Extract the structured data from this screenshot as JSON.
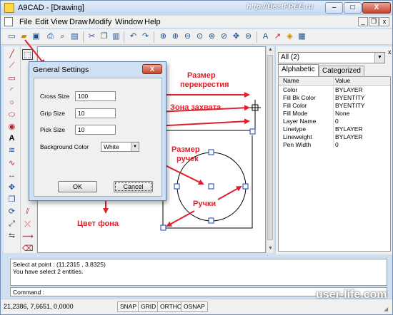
{
  "window": {
    "title": "A9CAD - [Drawing]",
    "controls": [
      "–",
      "□",
      "X"
    ]
  },
  "menu": {
    "items": [
      {
        "label": "File"
      },
      {
        "label": "Edit"
      },
      {
        "label": "View"
      },
      {
        "label": "Draw"
      },
      {
        "label": "Modify"
      },
      {
        "label": "Window"
      },
      {
        "label": "Help"
      }
    ],
    "mdi_controls": [
      "_",
      "❐",
      "x"
    ]
  },
  "toolbar": {
    "icons": [
      "new-icon",
      "open-icon",
      "save-icon",
      "print-icon",
      "print-preview-icon",
      "cut-icon",
      "copy-icon",
      "paste-icon",
      "undo-icon",
      "redo-icon",
      "zoom-window-icon",
      "zoom-in-icon",
      "zoom-out-icon",
      "zoom-all-icon",
      "zoom-extents-icon",
      "pan-icon",
      "zoom-previous-icon",
      "zoom-scale-icon",
      "text-style-icon",
      "layers-icon",
      "properties-icon"
    ]
  },
  "left_tools": [
    "line-icon",
    "polyline-icon",
    "rectangle-icon",
    "arc-icon",
    "circle-icon",
    "ellipse-icon",
    "point-icon",
    "text-icon",
    "hatch-icon",
    "spline-icon",
    "dimension-icon",
    "move-icon",
    "copy-entity-icon",
    "rotate-icon",
    "scale-icon",
    "mirror-icon",
    "offset-icon",
    "trim-icon",
    "extend-icon",
    "erase-icon"
  ],
  "dialog": {
    "title": "General Settings",
    "close_label": "X",
    "cross_size_label": "Cross Size",
    "cross_size_value": "100",
    "grip_size_label": "Grip Size",
    "grip_size_value": "10",
    "pick_size_label": "Pick Size",
    "pick_size_value": "10",
    "background_color_label": "Background Color",
    "background_color_value": "White",
    "ok_label": "OK",
    "cancel_label": "Cancel"
  },
  "properties_panel": {
    "selector_value": "All (2)",
    "close_label": "x",
    "tabs": [
      {
        "label": "Alphabetic",
        "active": true
      },
      {
        "label": "Categorized",
        "active": false
      }
    ],
    "headers": {
      "name": "Name",
      "value": "Value"
    },
    "rows": [
      {
        "name": "Color",
        "value": "BYLAYER"
      },
      {
        "name": "Fill Bk Color",
        "value": "BYENTITY"
      },
      {
        "name": "Fill Color",
        "value": "BYENTITY"
      },
      {
        "name": "Fill Mode",
        "value": "None"
      },
      {
        "name": "Layer Name",
        "value": "0"
      },
      {
        "name": "Linetype",
        "value": "BYLAYER"
      },
      {
        "name": "Lineweight",
        "value": "BYLAYER"
      },
      {
        "name": "Pen Width",
        "value": "0"
      }
    ]
  },
  "command_log": [
    "Select at point : (11.2315 , 3.8325)",
    "You have select 2 entities."
  ],
  "command_prompt": "Command :",
  "status": {
    "coordinates": "21,2386, 7,6651, 0,0000",
    "buttons": [
      "SNAP",
      "GRID",
      "ORTHO",
      "OSNAP"
    ]
  },
  "annotations": {
    "cross_size": [
      "Размер",
      "перекрестия"
    ],
    "grip_zone": "Зона захвата",
    "grip_size": [
      "Размер",
      "ручек"
    ],
    "grips": "Ручки",
    "background": "Цвет фона",
    "color": "#e11f2d"
  },
  "watermarks": {
    "top": "http://BestFREE.ru",
    "bottom": "user-life.com"
  }
}
